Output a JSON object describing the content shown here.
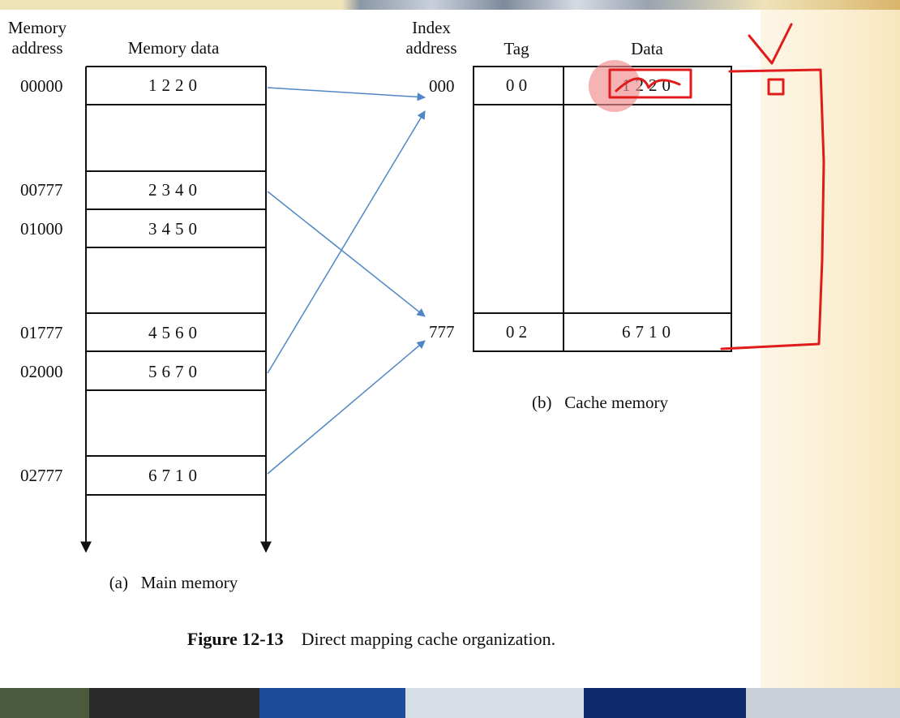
{
  "main_memory": {
    "header_address": "Memory\naddress",
    "header_data": "Memory data",
    "caption": "(a)   Main memory",
    "rows": [
      {
        "address": "00000",
        "value": "1220"
      },
      {
        "address": "00777",
        "value": "2340"
      },
      {
        "address": "01000",
        "value": "3450"
      },
      {
        "address": "01777",
        "value": "4560"
      },
      {
        "address": "02000",
        "value": "5670"
      },
      {
        "address": "02777",
        "value": "6710"
      }
    ]
  },
  "cache_memory": {
    "header_index": "Index\naddress",
    "header_tag": "Tag",
    "header_data": "Data",
    "caption": "(b)   Cache memory",
    "rows": [
      {
        "index": "000",
        "tag": "0 0",
        "data": "1220"
      },
      {
        "index": "777",
        "tag": "0 2",
        "data": "6710"
      }
    ]
  },
  "figure_caption": {
    "number": "Figure 12-13",
    "text": "Direct mapping cache organization."
  },
  "colors": {
    "arrow": "#4f86c6",
    "annotation": "#e01b1b",
    "highlight": "#f08a8a"
  }
}
